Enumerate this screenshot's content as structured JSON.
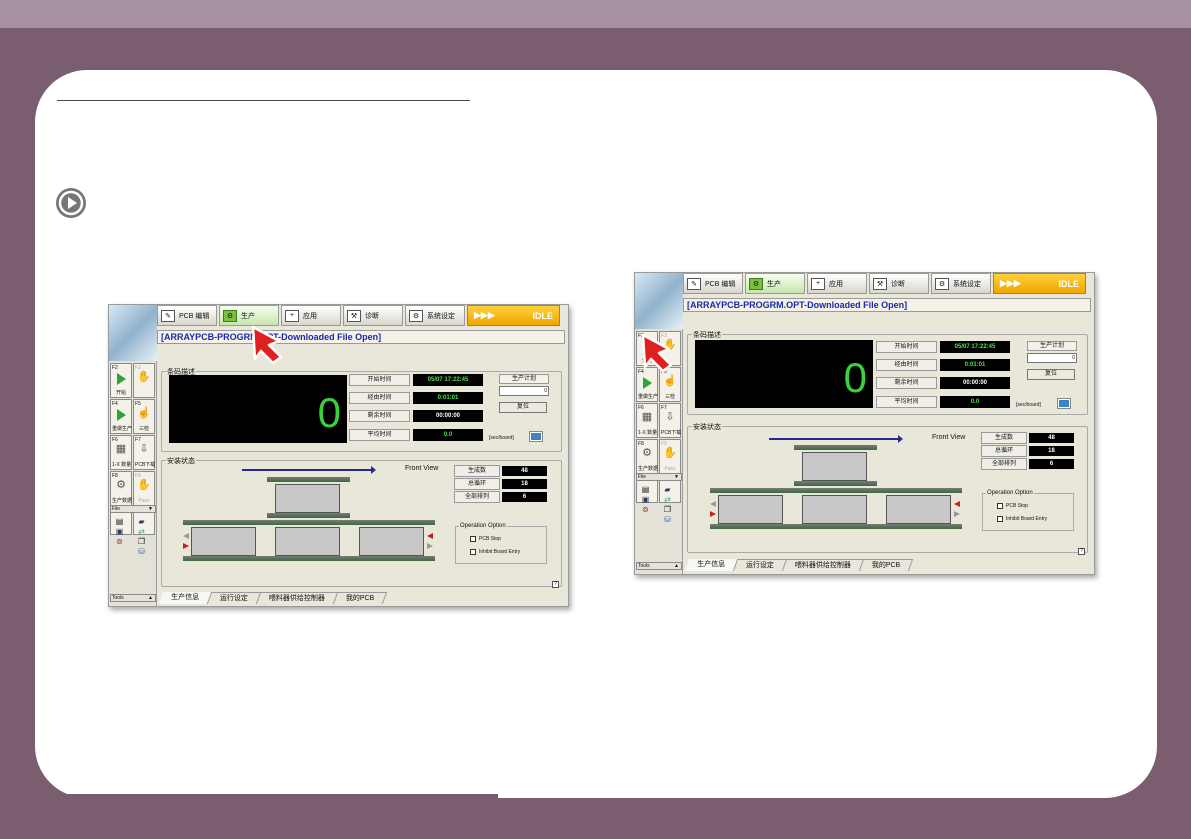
{
  "screens": [
    {
      "toolbar": {
        "pcb_edit": "PCB 编辑",
        "production": "生产",
        "apply": "应用",
        "diagnose": "诊断",
        "system": "系统设定",
        "idle_arrows": "▶▶▶",
        "idle": "IDLE"
      },
      "title": "[ARRAYPCB-PROGRM.OPT-Downloaded File Open]",
      "left_keys": [
        {
          "fkey": "F2",
          "label": "开始"
        },
        {
          "fkey": "F3",
          "label": ""
        },
        {
          "fkey": "F4",
          "label": "重做生产"
        },
        {
          "fkey": "F5",
          "label": "三检"
        },
        {
          "fkey": "F6",
          "label": "1-X 数量"
        },
        {
          "fkey": "F7",
          "label": "PCB下载"
        },
        {
          "fkey": "F8",
          "label": "生产数据"
        },
        {
          "fkey": "F9",
          "label": "Pass"
        },
        {
          "fkey": "F10",
          "label": ""
        },
        {
          "fkey": "F11",
          "label": ""
        }
      ],
      "file_label": "File",
      "tools_label": "Tools",
      "panel": {
        "group_label": "条码描述",
        "big_count": "0",
        "rows": [
          {
            "label": "开始时间",
            "value": "05/07 17:22:45"
          },
          {
            "label": "经由时间",
            "value": "0:01:01"
          },
          {
            "label": "剩余时间",
            "value": "00:00:00"
          },
          {
            "label": "平均时间",
            "value": "0.0"
          }
        ],
        "plan_label": "生产计划",
        "plan_value": "0",
        "reset": "复位",
        "unit": "[sec/board]"
      },
      "mount": {
        "group_label": "安装状态",
        "front_view": "Front View",
        "stats": [
          {
            "label": "生成数",
            "value": "48"
          },
          {
            "label": "总循环",
            "value": "18"
          },
          {
            "label": "全部排列",
            "value": "6"
          }
        ],
        "option_label": "Operation Option",
        "pcb_stop": "PCB Stop",
        "inhibit": "Inhibit Board Entry",
        "help": "?"
      },
      "tabs": [
        "生产信息",
        "运行设定",
        "喂料器供给控制器",
        "我的PCB"
      ]
    }
  ]
}
